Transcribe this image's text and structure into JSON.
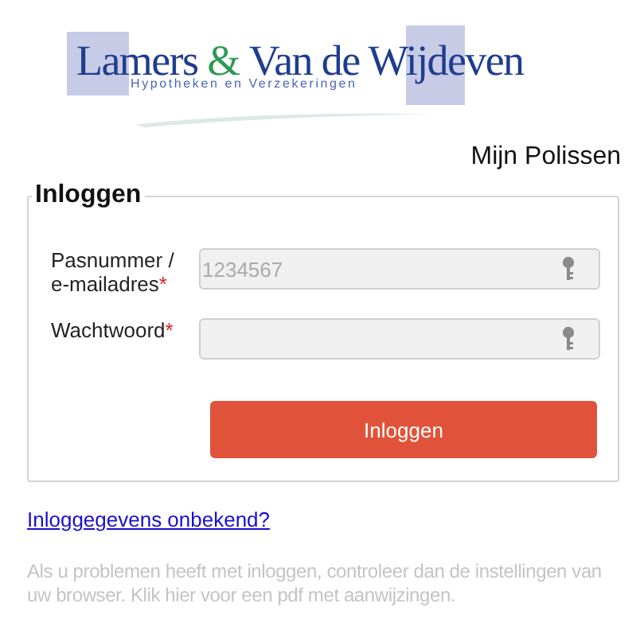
{
  "logo": {
    "words": [
      {
        "text": "Lamers",
        "kind": "plain"
      },
      {
        "text": "&",
        "kind": "accent"
      },
      {
        "text": "Van de Wijdeven",
        "kind": "plain"
      }
    ],
    "tagline": "Hypotheken en Verzekeringen"
  },
  "page_title": "Mijn Polissen",
  "login": {
    "legend": "Inloggen",
    "fields": [
      {
        "label": "Pasnummer / e-mailadres",
        "required": true,
        "placeholder": "1234567"
      },
      {
        "label": "Wachtwoord",
        "required": true
      }
    ],
    "required_mark": "*",
    "button": "Inloggen"
  },
  "forgot_link": "Inloggegevens onbekend?",
  "help_text": "Als u problemen heeft met inloggen, controleer dan de instellingen van uw browser. Klik hier voor een pdf met aanwijzingen."
}
